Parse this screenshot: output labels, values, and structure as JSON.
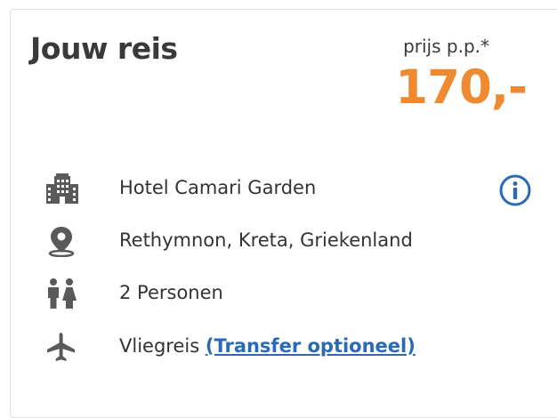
{
  "card": {
    "title": "Jouw reis",
    "price_label": "prijs p.p.*",
    "price_value": "170,-"
  },
  "details": {
    "hotel": "Hotel Camari Garden",
    "location": "Rethymnon, Kreta, Griekenland",
    "persons": "2 Personen",
    "travel_type": "Vliegreis",
    "transfer_link": "(Transfer optioneel)"
  },
  "icons": {
    "hotel": "building-icon",
    "location": "map-pin-icon",
    "persons": "people-icon",
    "travel": "airplane-icon",
    "info": "info-icon"
  },
  "colors": {
    "price": "#f08a30",
    "link": "#2a6ab5",
    "icon": "#5a5a5a",
    "text": "#333333"
  }
}
